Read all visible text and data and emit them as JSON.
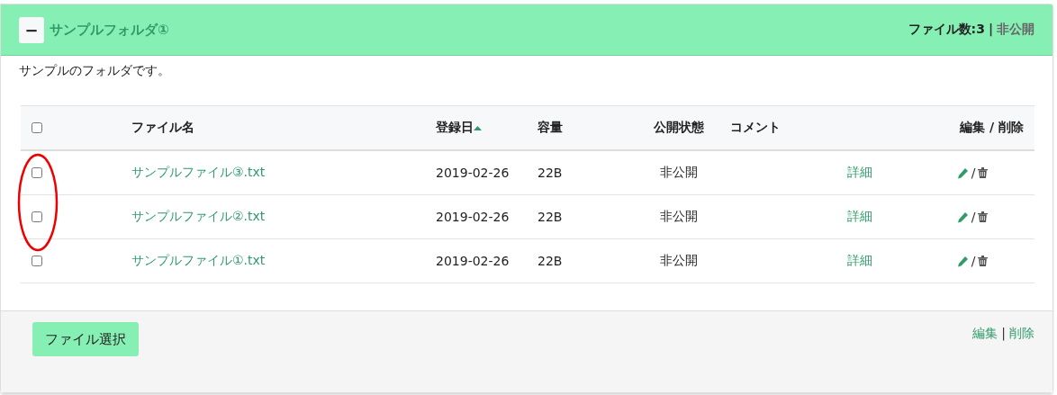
{
  "folder": {
    "expanded": true,
    "toggle": "−",
    "title": "サンプルフォルダ①",
    "file_count": "ファイル数:3",
    "separator": "|",
    "visibility": "非公開",
    "description": "サンプルのフォルダです。"
  },
  "table": {
    "select_all_checked": false,
    "columns": [
      {
        "label": "ファイル名",
        "sorted": false
      },
      {
        "label": "登録日",
        "sorted": true
      },
      {
        "label": "容量",
        "sorted": false
      },
      {
        "label": "公開状態",
        "sorted": false
      },
      {
        "label": "コメント",
        "sorted": false
      },
      {
        "label": "編集 / 削除",
        "sorted": false
      }
    ],
    "annotation": {
      "kind": "ellipse"
    },
    "rows": [
      {
        "checked": false,
        "name": "サンプルファイル③.txt",
        "date": "2019-02-26",
        "size": "22B",
        "status": "非公開",
        "detail": "詳細",
        "slash": "/"
      },
      {
        "checked": false,
        "name": "サンプルファイル②.txt",
        "date": "2019-02-26",
        "size": "22B",
        "status": "非公開",
        "detail": "詳細",
        "slash": "/"
      },
      {
        "checked": false,
        "name": "サンプルファイル①.txt",
        "date": "2019-02-26",
        "size": "22B",
        "status": "非公開",
        "detail": "詳細",
        "slash": "/"
      }
    ]
  },
  "footer": {
    "button": "ファイル選択",
    "edit_link": "編集",
    "separator": "|",
    "delete_link": "削除"
  }
}
